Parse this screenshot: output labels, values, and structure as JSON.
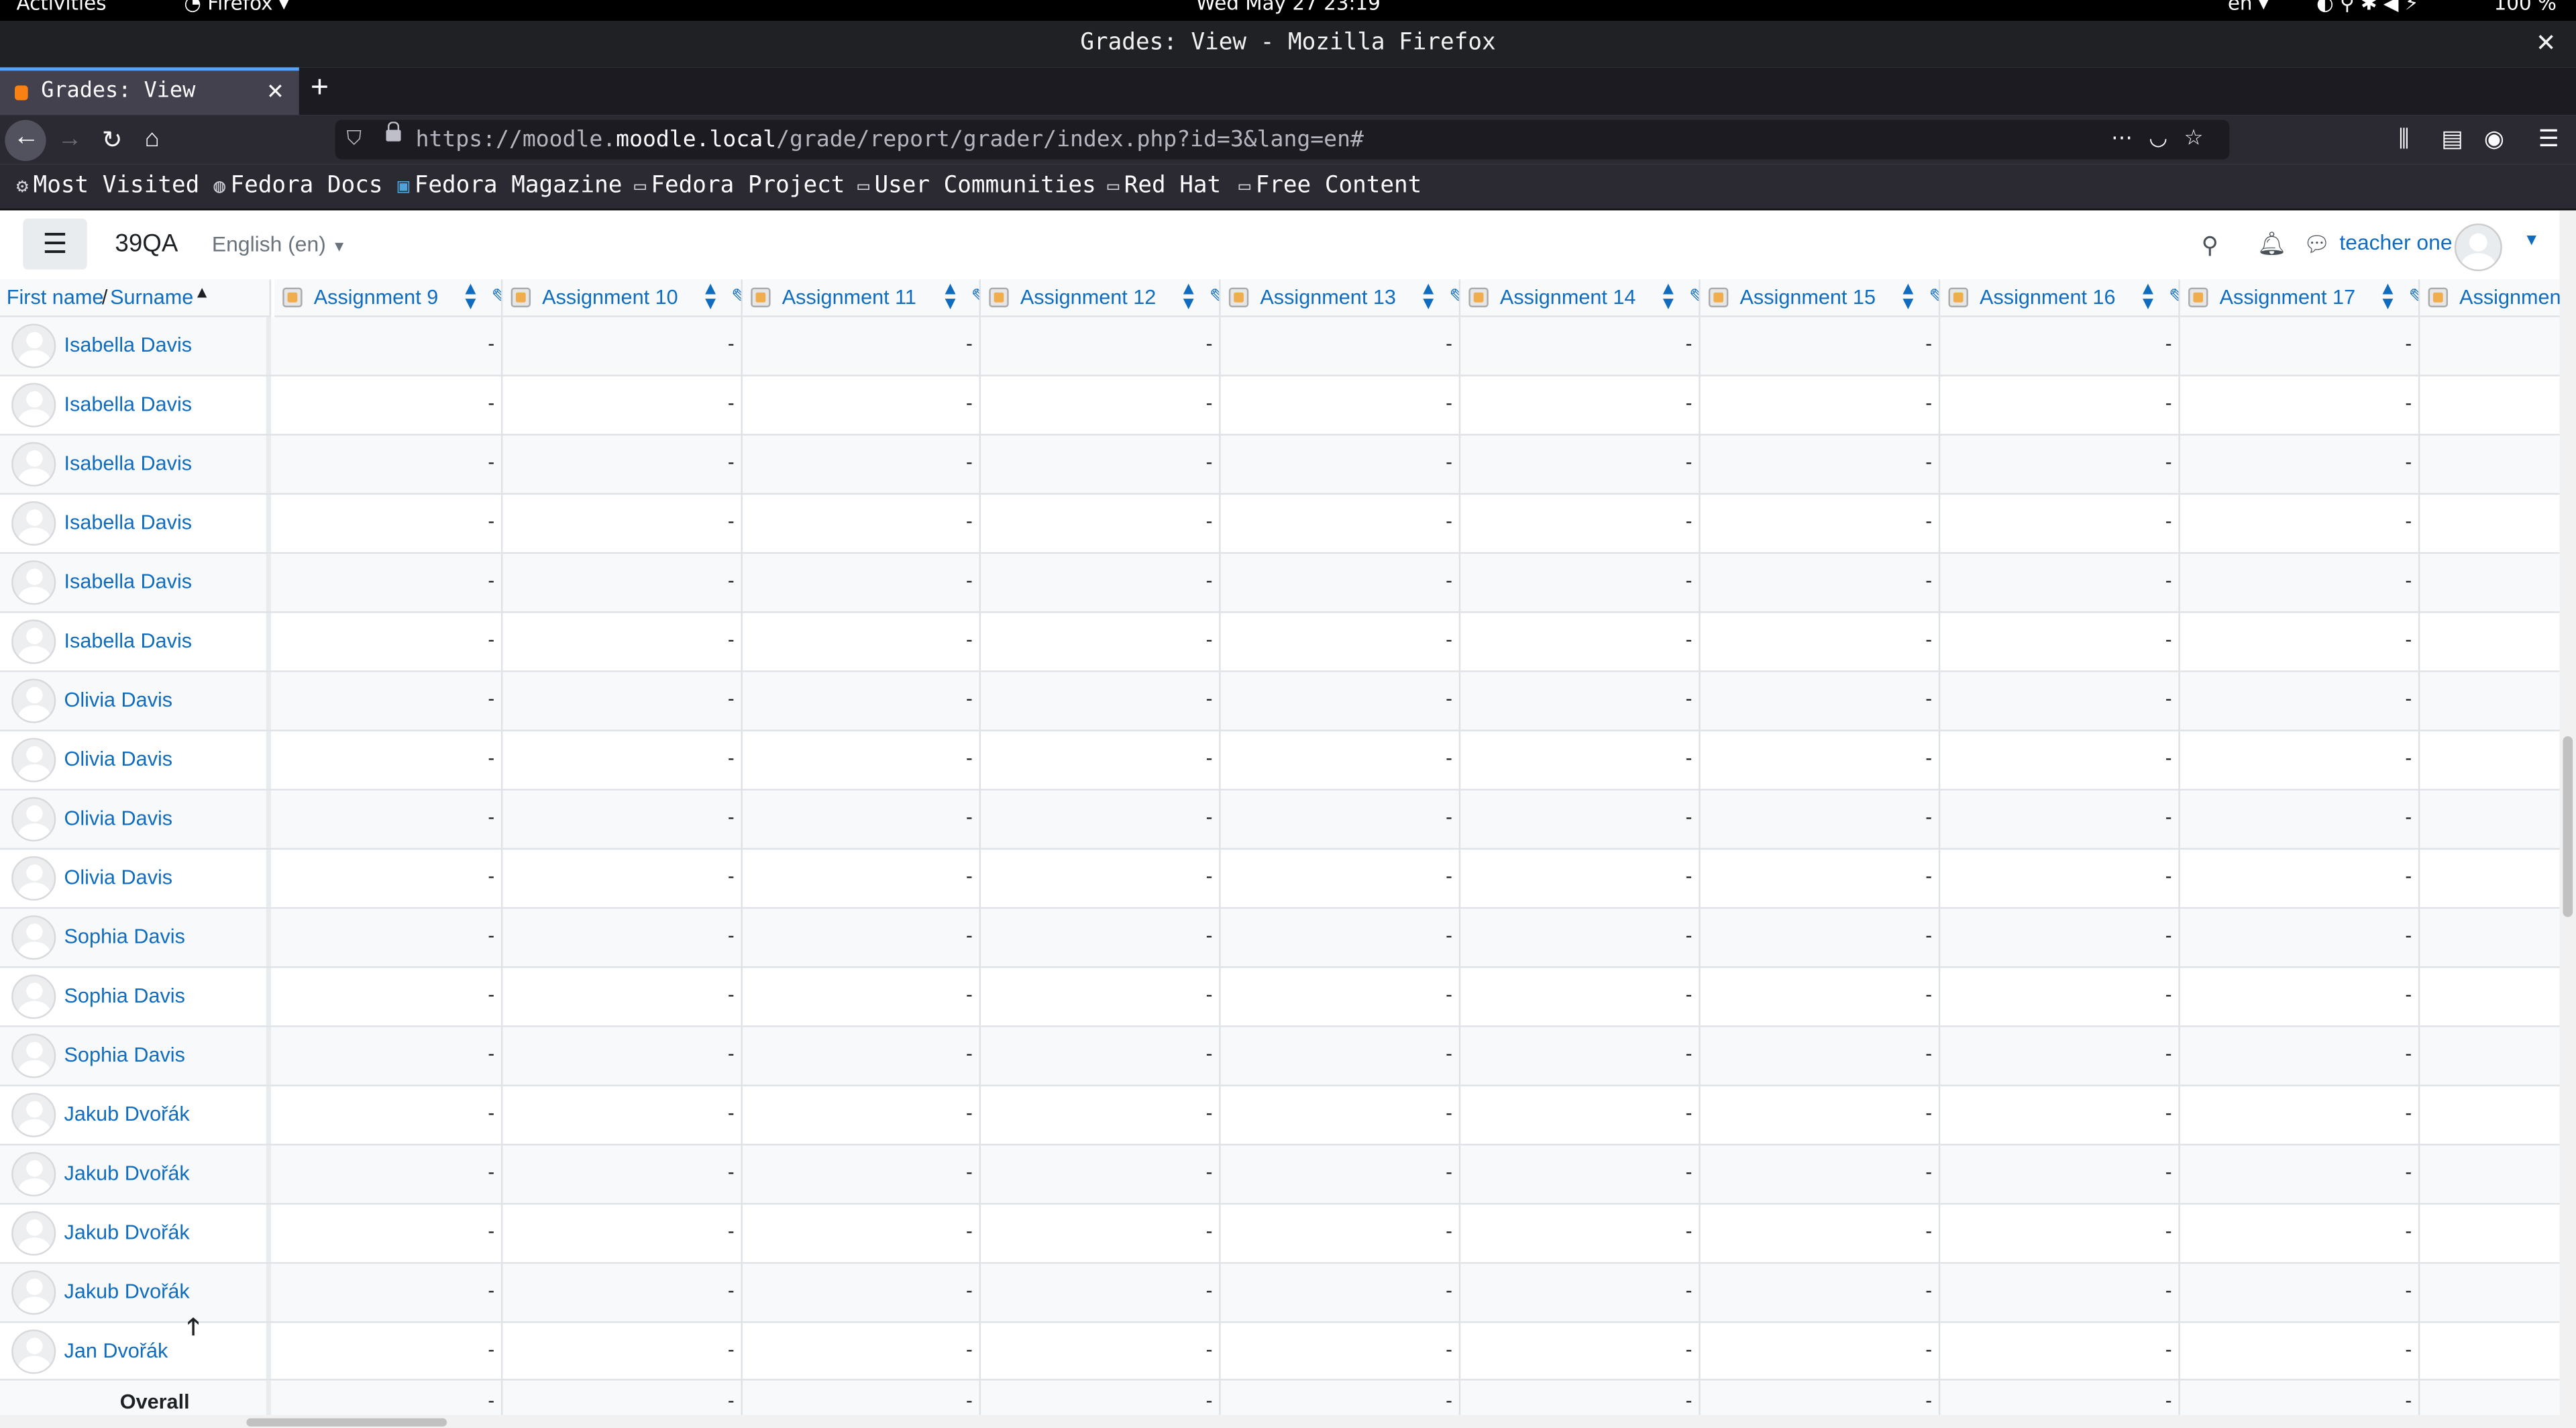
{
  "system_bar": {
    "activities": "Activities",
    "app_menu": "Firefox",
    "clock": "Wed May 27 23:19",
    "input_lang": "en",
    "battery": "100 %"
  },
  "window": {
    "title": "Grades: View - Mozilla Firefox"
  },
  "tabs": [
    {
      "label": "Grades: View",
      "active": true
    }
  ],
  "address_bar": {
    "url_prefix": "https://moodle.",
    "url_domain": "moodle.local",
    "url_path": "/grade/report/grader/index.php?id=3&lang=en#"
  },
  "bookmarks": [
    {
      "label": "Most Visited",
      "icon": "gear-icon"
    },
    {
      "label": "Fedora Docs",
      "icon": "globe-icon"
    },
    {
      "label": "Fedora Magazine",
      "icon": "fedora-magazine-icon"
    },
    {
      "label": "Fedora Project",
      "icon": "folder-icon"
    },
    {
      "label": "User Communities",
      "icon": "folder-icon"
    },
    {
      "label": "Red Hat",
      "icon": "folder-icon"
    },
    {
      "label": "Free Content",
      "icon": "folder-icon"
    }
  ],
  "moodle_nav": {
    "brand": "39QA",
    "language": "English (en)",
    "user_name": "teacher one"
  },
  "table": {
    "name_header": {
      "first_name": "First name",
      "separator": "/",
      "surname": "Surname"
    },
    "columns": [
      "Assignment 9",
      "Assignment 10",
      "Assignment 11",
      "Assignment 12",
      "Assignment 13",
      "Assignment 14",
      "Assignment 15",
      "Assignment 16",
      "Assignment 17",
      "Assignment"
    ],
    "empty_grade": "-",
    "rows": [
      "Isabella Davis",
      "Isabella Davis",
      "Isabella Davis",
      "Isabella Davis",
      "Isabella Davis",
      "Isabella Davis",
      "Olivia Davis",
      "Olivia Davis",
      "Olivia Davis",
      "Olivia Davis",
      "Sophia Davis",
      "Sophia Davis",
      "Sophia Davis",
      "Jakub Dvořák",
      "Jakub Dvořák",
      "Jakub Dvořák",
      "Jakub Dvořák",
      "Jan Dvořák"
    ],
    "overall_average_label": "Overall average"
  },
  "colors": {
    "link": "#0f6cbf",
    "firefox_chrome": "#2b2a33",
    "row_stripe": "#f8f9fa"
  }
}
